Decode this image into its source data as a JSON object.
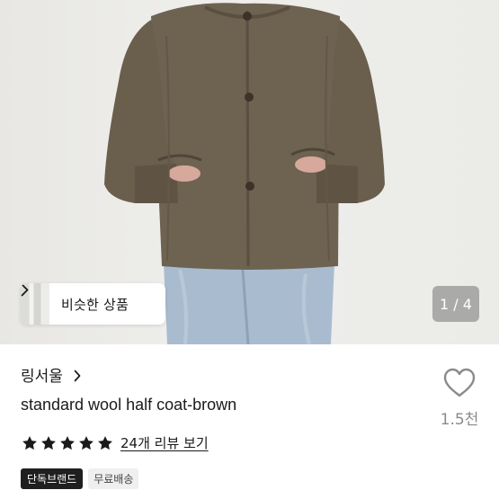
{
  "photo": {
    "similar_button_label": "비슷한 상품",
    "page_indicator": "1 / 4"
  },
  "product": {
    "shop_name": "링서울",
    "title": "standard wool half coat-brown",
    "rating_stars": 5,
    "review_link": "24개 리뷰 보기",
    "like_count": "1.5천",
    "badges": [
      "단독브랜드",
      "무료배송"
    ]
  },
  "colors": {
    "coat": "#6f6352",
    "jeans": "#9fb3c8",
    "star": "#1a1a1a",
    "like_icon": "#8a8a8a"
  }
}
